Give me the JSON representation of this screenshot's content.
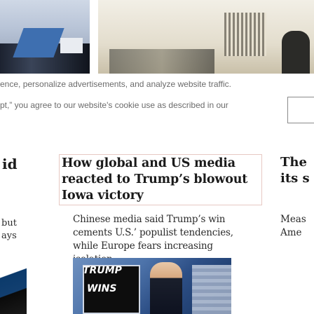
{
  "cookie_banner": {
    "line1": "ence, personalize advertisements, and analyze website traffic.",
    "line2": "pt,” you agree to our website's cookie use as described in our"
  },
  "articles": {
    "left_fragment": {
      "title": "id",
      "body_lines": [
        "but",
        "ays"
      ]
    },
    "main": {
      "headline": "How global and US media reacted to Trump’s blowout Iowa victory",
      "summary": "Chinese media said Trump’s win cements U.S.’ populist tendencies, while Europe fears increasing isolation.",
      "thumbnail_text": [
        "TRUMP",
        "WINS"
      ]
    },
    "right_fragment": {
      "title_lines": [
        "The",
        "its s"
      ],
      "body_lines": [
        "Meas",
        "Ame"
      ]
    }
  },
  "colors": {
    "headline_border": "#e7c9c3",
    "cookie_text": "#6b6b6b",
    "body_text": "#2a2a2a"
  }
}
